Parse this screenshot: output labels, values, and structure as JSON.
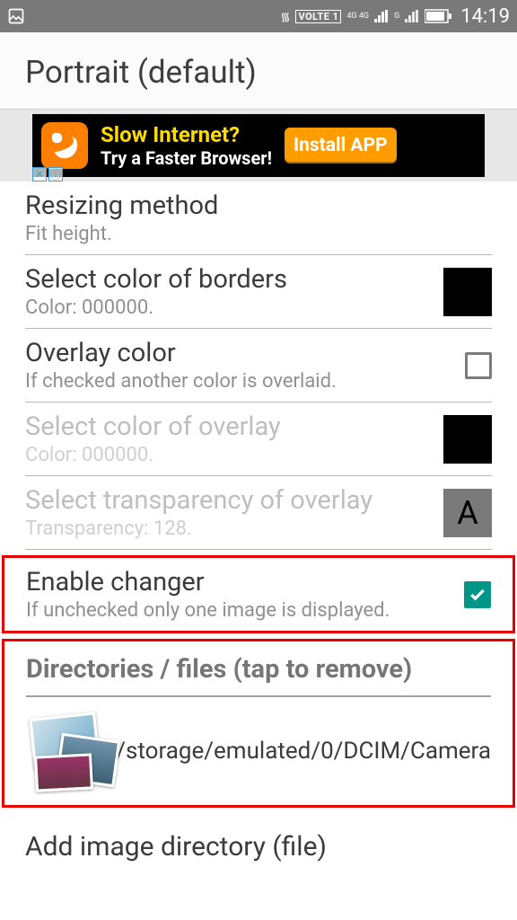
{
  "statusbar": {
    "volte": "VOLTE 1",
    "net": "4G 4G",
    "g": "G",
    "time": "14:19"
  },
  "header": {
    "title": "Portrait (default)"
  },
  "ad": {
    "headline": "Slow Internet?",
    "sub": "Try a Faster Browser!",
    "cta": "Install APP"
  },
  "settings": {
    "resize": {
      "title": "Resizing method",
      "sub": "Fit height."
    },
    "border": {
      "title": "Select color of borders",
      "sub": "Color: 000000."
    },
    "overlay": {
      "title": "Overlay color",
      "sub": "If checked another color is overlaid."
    },
    "overlayColor": {
      "title": "Select color of overlay",
      "sub": "Color: 000000."
    },
    "overlayTrans": {
      "title": "Select transparency of overlay",
      "sub": "Transparency: 128.",
      "badge": "A"
    },
    "enable": {
      "title": "Enable changer",
      "sub": "If unchecked only one image is displayed."
    }
  },
  "dir": {
    "heading": "Directories / files (tap to remove)",
    "path": "/storage/emulated/0/DCIM/Camera"
  },
  "addDir": "Add image directory (file)"
}
